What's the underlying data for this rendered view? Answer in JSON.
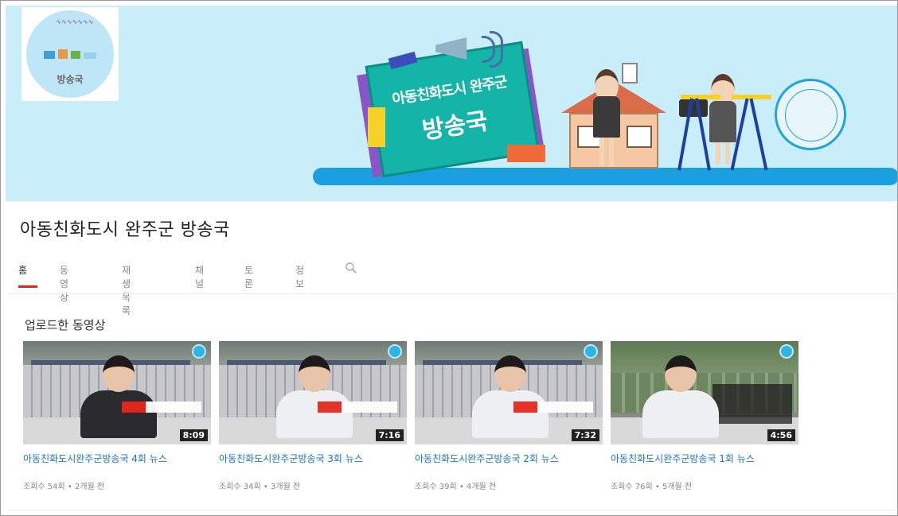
{
  "banner": {
    "logo_text": "방송국",
    "board_line1": "아동친화도시 완주군",
    "board_line2": "방송국"
  },
  "channel": {
    "title": "아동친화도시 완주군 방송국"
  },
  "tabs": [
    {
      "label": "홈",
      "active": true
    },
    {
      "label": "동영상"
    },
    {
      "label": "재생목록"
    },
    {
      "label": "채널"
    },
    {
      "label": "토론"
    },
    {
      "label": "정보"
    }
  ],
  "uploads": {
    "section_title": "업로드한 동영상",
    "videos": [
      {
        "title": "아동친화도시완주군방송국 4회 뉴스",
        "duration": "8:09",
        "meta": "조회수 54회 • 2개월 전"
      },
      {
        "title": "아동친화도시완주군방송국 3회 뉴스",
        "duration": "7:16",
        "meta": "조회수 34회 • 3개월 전"
      },
      {
        "title": "아동친화도시완주군방송국 2회 뉴스",
        "duration": "7:32",
        "meta": "조회수 39회 • 4개월 전"
      },
      {
        "title": "아동친화도시완주군방송국 1회 뉴스",
        "duration": "4:56",
        "meta": "조회수 76회 • 5개월 전"
      }
    ]
  },
  "colors": {
    "banner_bg": "#c9eefa",
    "accent_red": "#e5271b",
    "link_blue": "#1a73c8"
  }
}
